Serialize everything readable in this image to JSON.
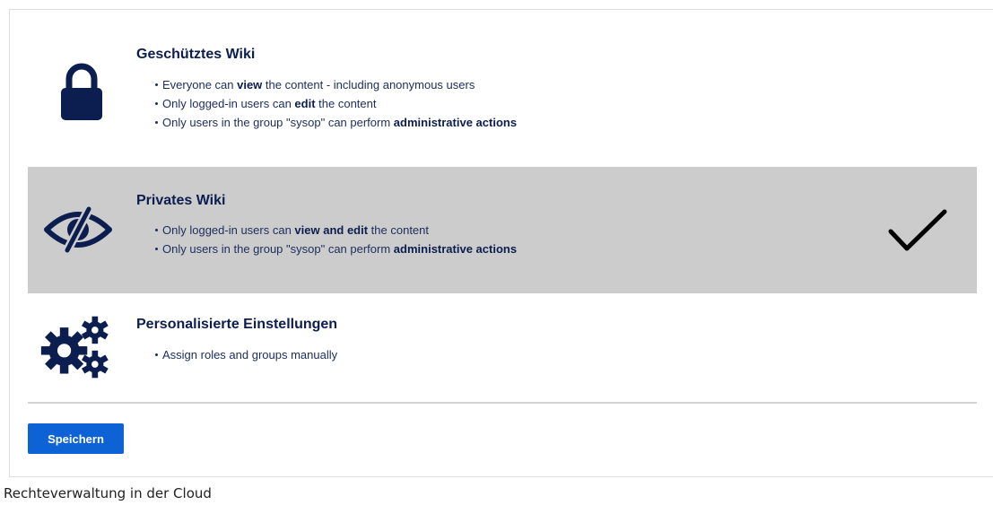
{
  "options": [
    {
      "icon": "lock-icon",
      "title": "Geschütztes Wiki",
      "bullets": [
        {
          "pre": "Everyone can ",
          "bold": "view",
          "post": " the content - including anonymous users"
        },
        {
          "pre": "Only logged-in users can ",
          "bold": "edit",
          "post": " the content"
        },
        {
          "pre": "Only users in the group \"sysop\" can perform ",
          "bold": "administrative actions",
          "post": ""
        }
      ],
      "selected": false
    },
    {
      "icon": "eye-slash-icon",
      "title": "Privates Wiki",
      "bullets": [
        {
          "pre": "Only logged-in users can ",
          "bold": "view and edit",
          "post": " the content"
        },
        {
          "pre": "Only users in the group \"sysop\" can perform ",
          "bold": "administrative actions",
          "post": ""
        }
      ],
      "selected": true
    },
    {
      "icon": "gears-icon",
      "title": "Personalisierte Einstellungen",
      "bullets": [
        {
          "pre": "Assign roles and groups manually",
          "bold": "",
          "post": ""
        }
      ],
      "selected": false
    }
  ],
  "selected_icon": "checkmark-icon",
  "save_label": "Speichern",
  "caption": "Rechteverwaltung in der Cloud",
  "colors": {
    "icon": "#0c1e4f",
    "title": "#0c1e4f",
    "selected_background": "#cccccc",
    "button": "#0d63d6",
    "button_text": "#ffffff",
    "divider": "#d2d2d2"
  }
}
